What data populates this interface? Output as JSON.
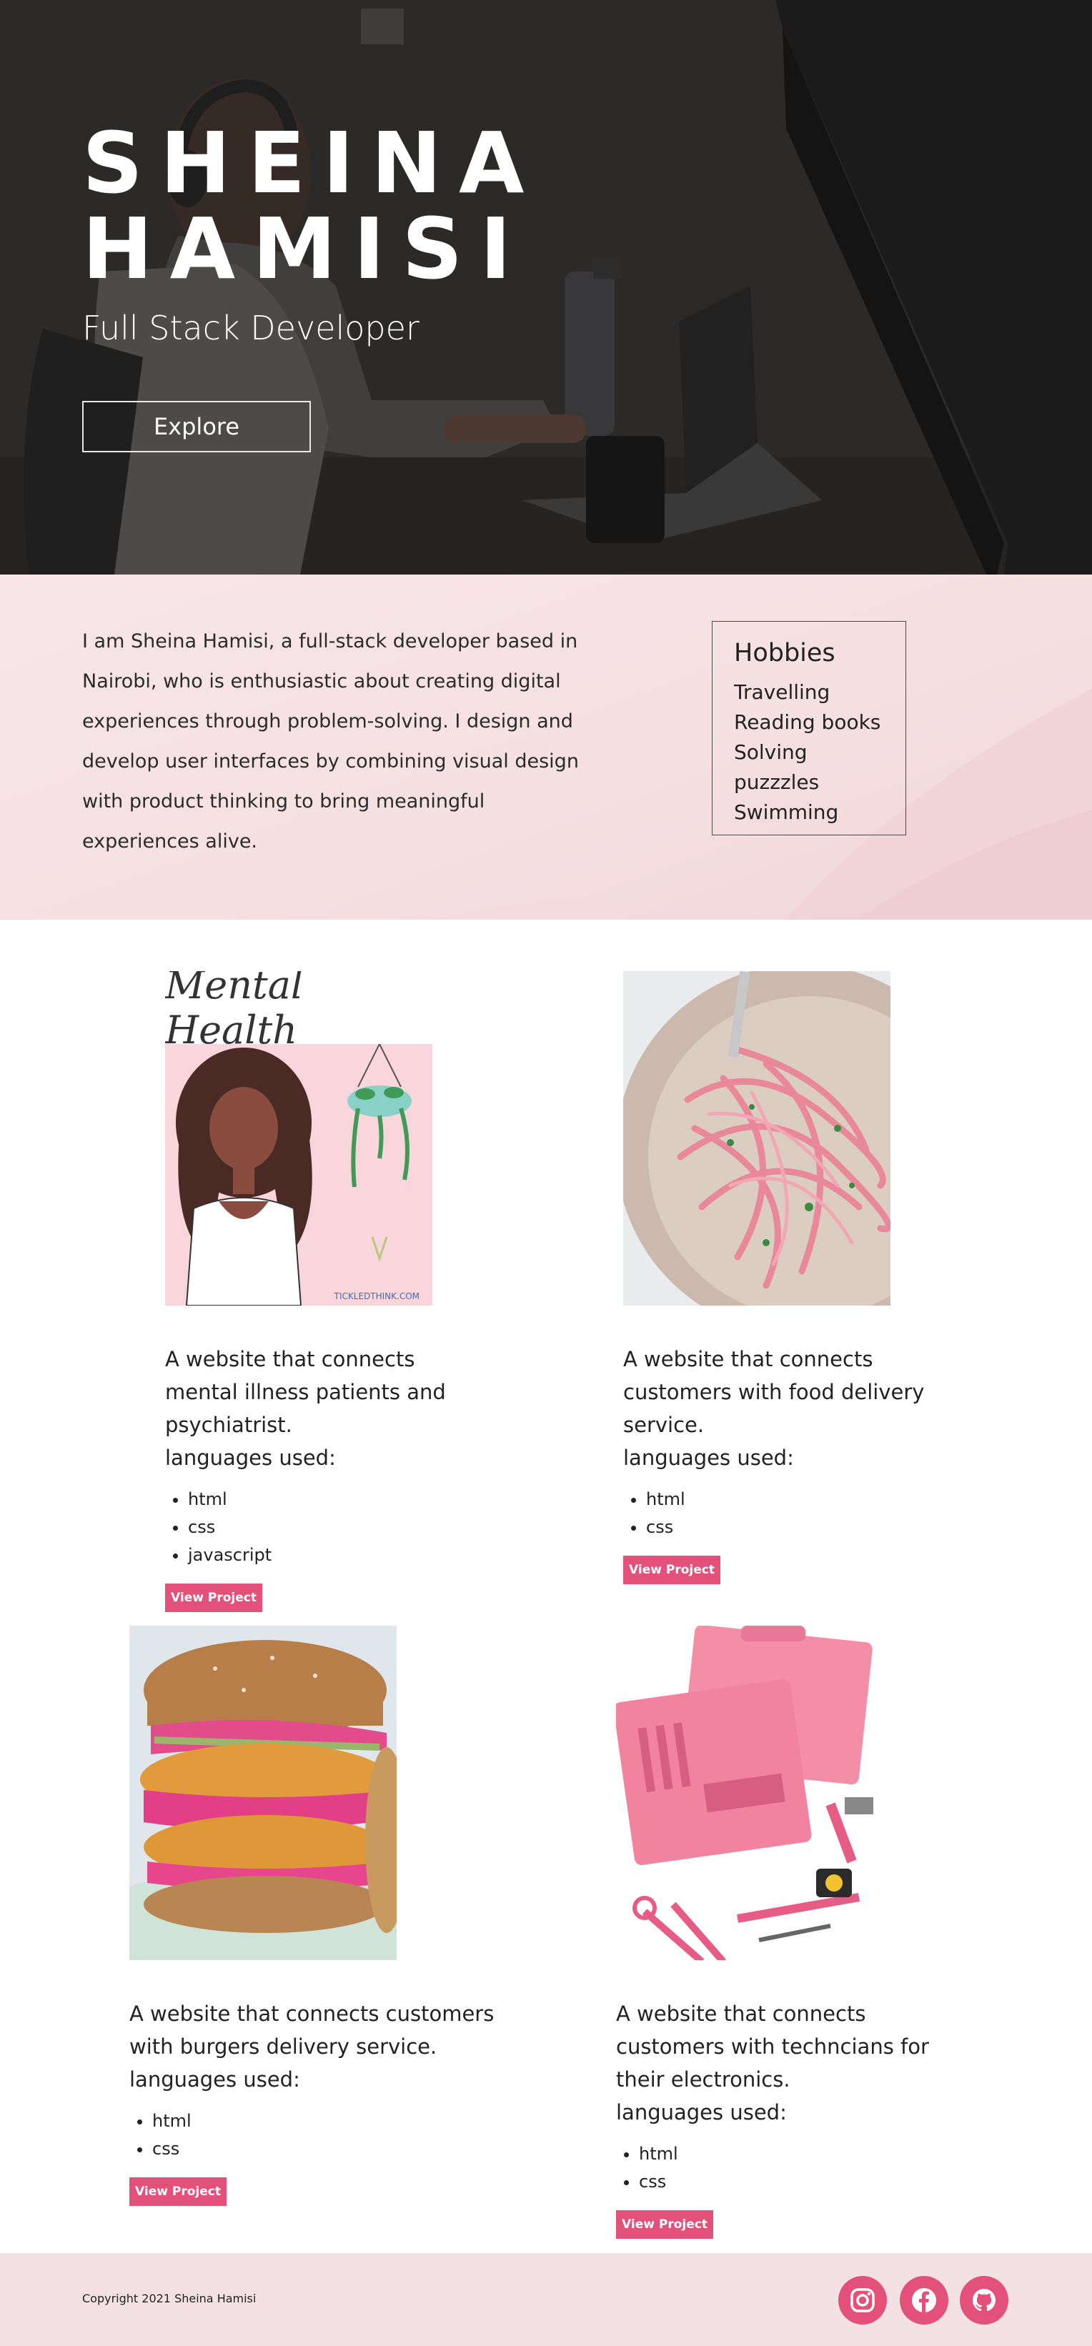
{
  "hero": {
    "name_line1": "SHEINA",
    "name_line2": "HAMISI",
    "subtitle": "Full Stack Developer",
    "explore_label": "Explore"
  },
  "about": {
    "bio": "I am Sheina Hamisi, a full-stack developer based in Nairobi, who is enthusiastic about creating digital experiences through problem-solving. I design and develop user interfaces by combining visual design with product thinking to bring meaningful experiences alive.",
    "hobbies_title": "Hobbies",
    "hobbies": [
      "Travelling",
      "Reading books",
      "Solving puzzzles",
      "Swimming"
    ]
  },
  "projects": [
    {
      "image_caption": "Mental Health",
      "image_watermark": "TICKLEDTHINK.COM",
      "description": "A website that connects mental illness patients and psychiatrist.",
      "languages_label": "languages used:",
      "languages": [
        "html",
        "css",
        "javascript"
      ],
      "button": "View Project"
    },
    {
      "description": "A website that connects customers with food delivery service.",
      "languages_label": "languages used:",
      "languages": [
        "html",
        "css"
      ],
      "button": "View Project"
    },
    {
      "description": "A website that connects customers with burgers delivery service.",
      "languages_label": "languages used:",
      "languages": [
        "html",
        "css"
      ],
      "button": "View Project"
    },
    {
      "description": "A website that connects customers with techncians for their electronics.",
      "languages_label": "languages used:",
      "languages": [
        "html",
        "css"
      ],
      "button": "View Project"
    }
  ],
  "footer": {
    "copyright": "Copyright 2021 Sheina Hamisi",
    "social": [
      "instagram-icon",
      "facebook-icon",
      "github-icon"
    ]
  },
  "colors": {
    "accent": "#e3517a",
    "about_bg": "#f5e0e2",
    "footer_bg": "#f4e1e3"
  }
}
